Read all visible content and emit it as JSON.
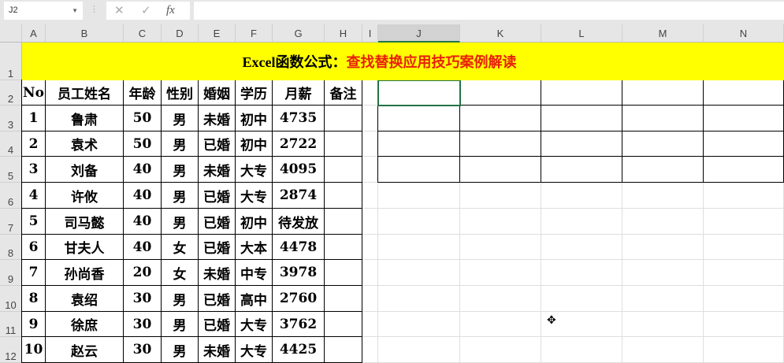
{
  "formula_bar": {
    "name_box": "J2",
    "cancel": "✕",
    "enter": "✓",
    "fx": "fx",
    "value": ""
  },
  "columns": [
    "A",
    "B",
    "C",
    "D",
    "E",
    "F",
    "G",
    "H",
    "I",
    "J",
    "K",
    "L",
    "M",
    "N"
  ],
  "rows": [
    "1",
    "2",
    "3",
    "4",
    "5",
    "6",
    "7",
    "8",
    "9",
    "10",
    "11",
    "12"
  ],
  "title": {
    "black": "Excel函数公式：",
    "red": "查找替换应用技巧案例解读"
  },
  "headers": [
    "No",
    "员工姓名",
    "年龄",
    "性别",
    "婚姻",
    "学历",
    "月薪",
    "备注"
  ],
  "data": [
    [
      "1",
      "鲁肃",
      "50",
      "男",
      "未婚",
      "初中",
      "4735",
      ""
    ],
    [
      "2",
      "袁术",
      "50",
      "男",
      "已婚",
      "初中",
      "2722",
      ""
    ],
    [
      "3",
      "刘备",
      "40",
      "男",
      "未婚",
      "大专",
      "4095",
      ""
    ],
    [
      "4",
      "许攸",
      "40",
      "男",
      "已婚",
      "大专",
      "2874",
      ""
    ],
    [
      "5",
      "司马懿",
      "40",
      "男",
      "已婚",
      "初中",
      "待发放",
      ""
    ],
    [
      "6",
      "甘夫人",
      "40",
      "女",
      "已婚",
      "大本",
      "4478",
      ""
    ],
    [
      "7",
      "孙尚香",
      "20",
      "女",
      "未婚",
      "中专",
      "3978",
      ""
    ],
    [
      "8",
      "袁绍",
      "30",
      "男",
      "已婚",
      "高中",
      "2760",
      ""
    ],
    [
      "9",
      "徐庶",
      "30",
      "男",
      "已婚",
      "大专",
      "3762",
      ""
    ],
    [
      "10",
      "赵云",
      "30",
      "男",
      "未婚",
      "大专",
      "4425",
      ""
    ]
  ],
  "selected_cell": "J2"
}
